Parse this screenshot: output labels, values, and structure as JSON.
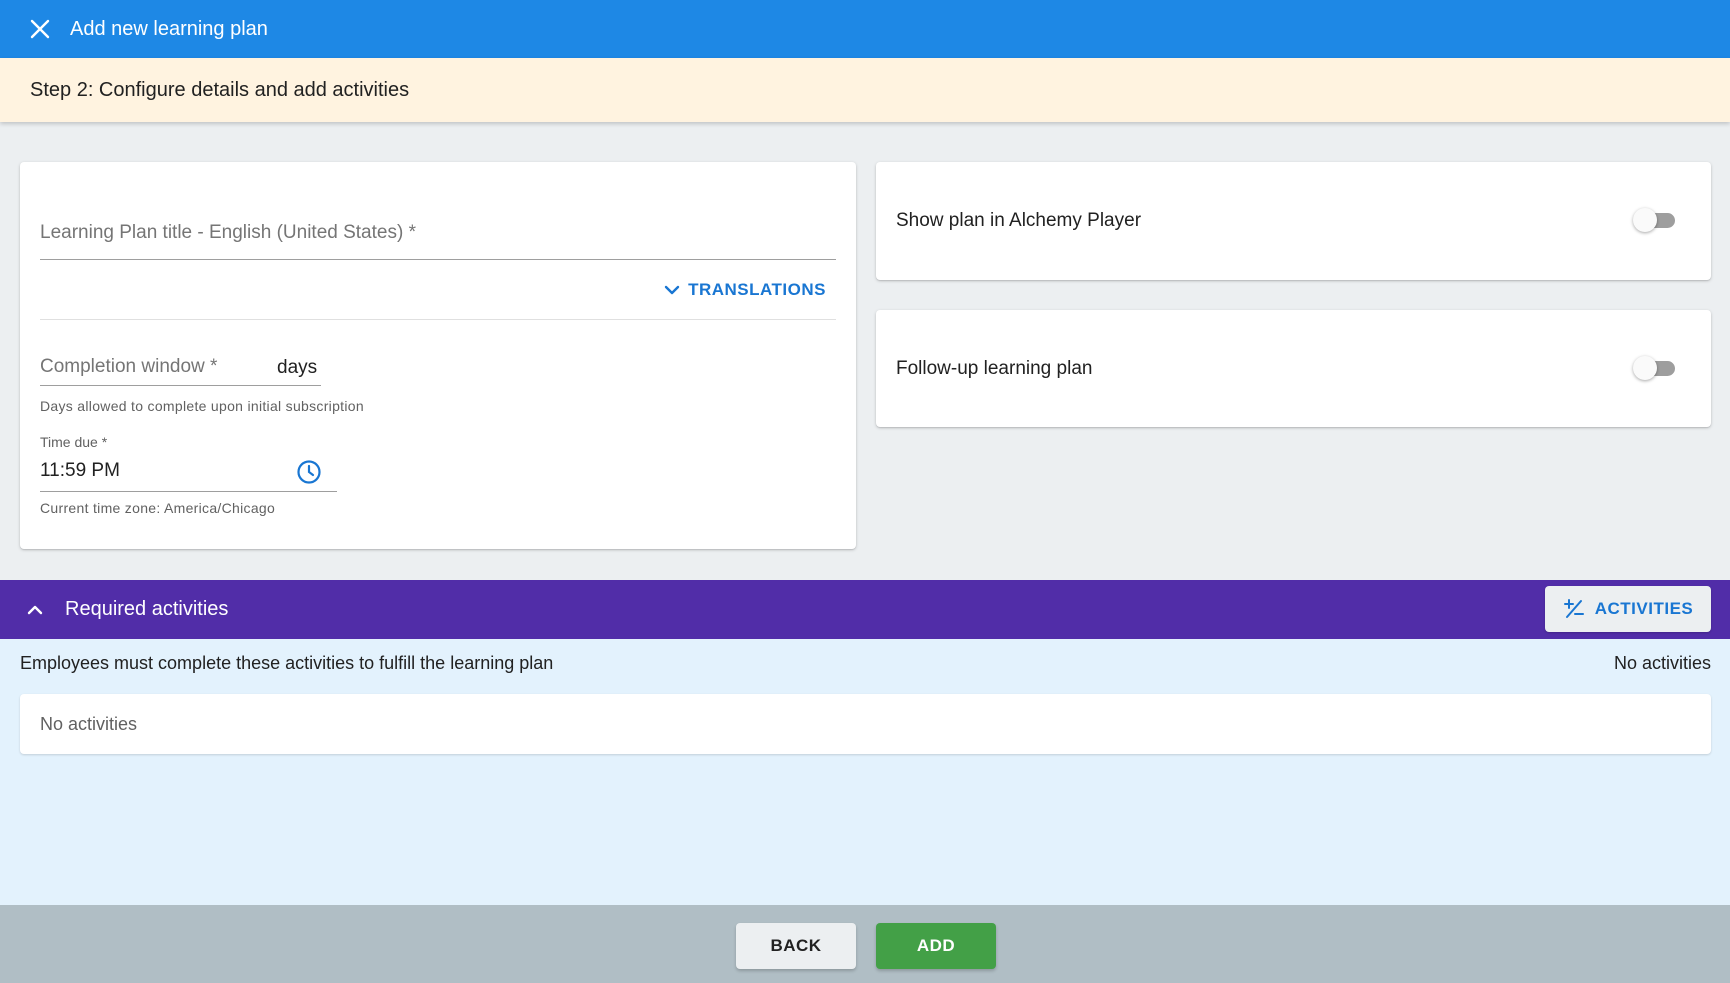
{
  "header": {
    "title": "Add new learning plan",
    "close_icon": "close-icon",
    "color": "#1e88e5"
  },
  "step": {
    "title": "Step 2: Configure details and add activities",
    "color": "#fff3e0"
  },
  "details": {
    "title_field": {
      "label": "Learning Plan title - English (United States) *",
      "value": ""
    },
    "translations_label": "TRANSLATIONS",
    "completion_window": {
      "label": "Completion window *",
      "value": "",
      "suffix": "days",
      "hint": "Days allowed to complete upon initial subscription"
    },
    "time_due": {
      "label": "Time due *",
      "value": "11:59 PM",
      "icon": "clock-icon",
      "hint": "Current time zone: America/Chicago"
    }
  },
  "options": {
    "show_in_player": {
      "label": "Show plan in Alchemy Player",
      "enabled": false
    },
    "follow_up": {
      "label": "Follow-up learning plan",
      "enabled": false
    }
  },
  "required_activities": {
    "title": "Required activities",
    "color": "#512da8",
    "button_label": "ACTIVITIES",
    "description": "Employees must complete these activities to fulfill the learning plan",
    "count_text": "No activities",
    "empty_text": "No activities"
  },
  "footer": {
    "back_label": "BACK",
    "add_label": "ADD",
    "add_color": "#43a047"
  }
}
